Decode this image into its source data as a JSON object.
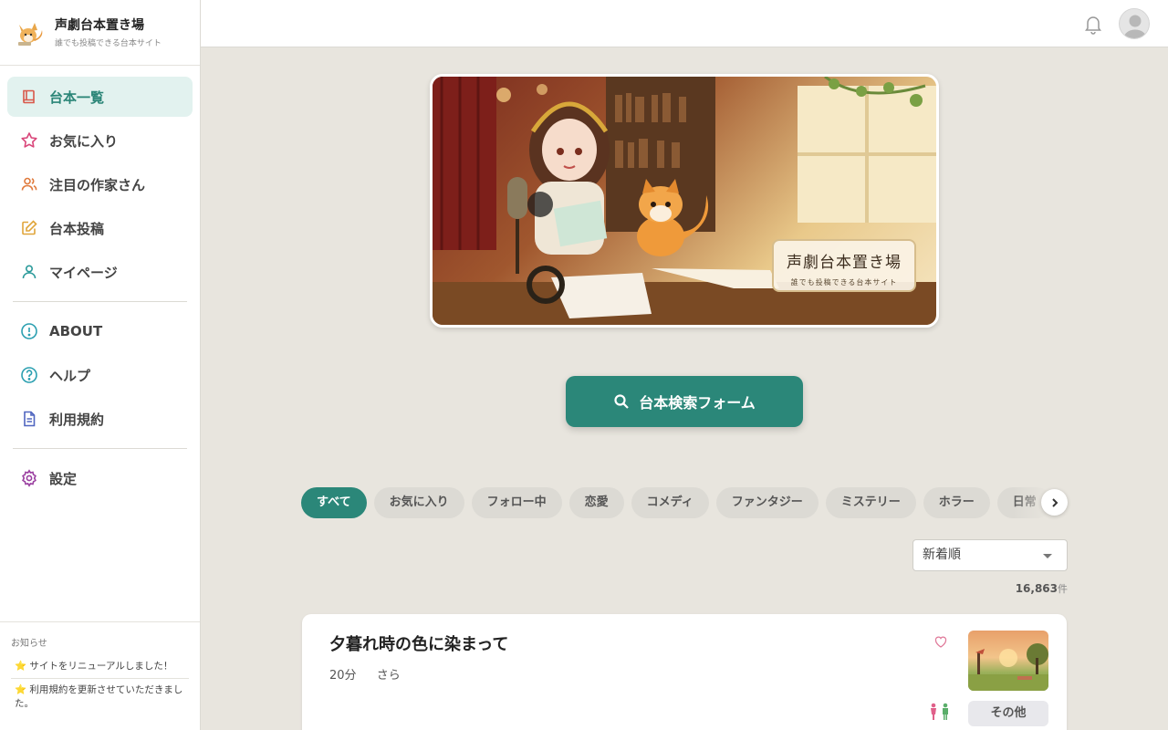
{
  "brand": {
    "title": "声劇台本置き場",
    "subtitle": "誰でも投稿できる台本サイト"
  },
  "sidebar": {
    "items": [
      {
        "label": "台本一覧",
        "icon": "book-icon",
        "active": true
      },
      {
        "label": "お気に入り",
        "icon": "star-icon"
      },
      {
        "label": "注目の作家さん",
        "icon": "users-icon"
      },
      {
        "label": "台本投稿",
        "icon": "edit-icon"
      },
      {
        "label": "マイページ",
        "icon": "user-icon"
      },
      {
        "label": "ABOUT",
        "icon": "info-icon"
      },
      {
        "label": "ヘルプ",
        "icon": "help-icon"
      },
      {
        "label": "利用規約",
        "icon": "document-icon"
      },
      {
        "label": "設定",
        "icon": "gear-icon"
      }
    ]
  },
  "news": {
    "title": "お知らせ",
    "items": [
      "⭐ サイトをリニューアルしました！",
      "⭐ 利用規約を更新させていただきました。"
    ]
  },
  "hero": {
    "badge_title": "声劇台本置き場",
    "badge_subtitle": "誰でも投稿できる台本サイト"
  },
  "search_button": "台本検索フォーム",
  "tabs": [
    "すべて",
    "お気に入り",
    "フォロー中",
    "恋愛",
    "コメディ",
    "ファンタジー",
    "ミステリー",
    "ホラー",
    "日常"
  ],
  "sort": {
    "value": "新着順"
  },
  "count": {
    "value": "16,863",
    "unit": "件"
  },
  "card": {
    "title": "夕暮れ時の色に染まって",
    "duration": "20分",
    "author": "さら",
    "genre": "その他"
  },
  "colors": {
    "accent": "#2b8779",
    "background": "#e8e5de"
  }
}
